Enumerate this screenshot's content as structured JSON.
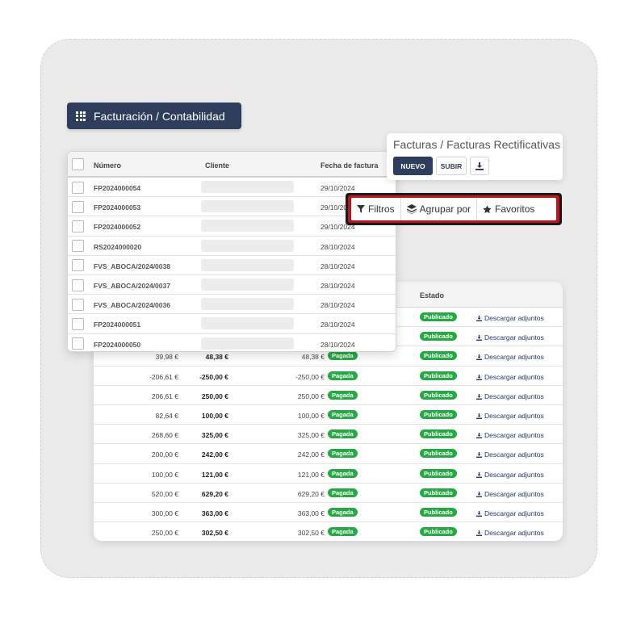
{
  "breadcrumb": {
    "label": "Facturación / Contabilidad"
  },
  "panel": {
    "title": "Facturas / Facturas Rectificativas",
    "buttons": {
      "nuevo": "NUEVO",
      "subir": "SUBIR"
    }
  },
  "filters": {
    "filtros": "Filtros",
    "agrupar": "Agrupar por",
    "favoritos": "Favoritos"
  },
  "colors": {
    "primary": "#2d3e5c",
    "highlight": "#c0141b",
    "success": "#28a745"
  },
  "front_table": {
    "headers": {
      "numero": "Número",
      "cliente": "Cliente",
      "fecha": "Fecha de factura"
    },
    "rows": [
      {
        "numero": "FP2024000054",
        "fecha": "29/10/2024"
      },
      {
        "numero": "FP2024000053",
        "fecha": "29/10/2024"
      },
      {
        "numero": "FP2024000052",
        "fecha": "29/10/2024"
      },
      {
        "numero": "RS2024000020",
        "fecha": "28/10/2024"
      },
      {
        "numero": "FVS_ABOCA/2024/0038",
        "fecha": "28/10/2024"
      },
      {
        "numero": "FVS_ABOCA/2024/0037",
        "fecha": "28/10/2024"
      },
      {
        "numero": "FVS_ABOCA/2024/0036",
        "fecha": "28/10/2024"
      },
      {
        "numero": "FP2024000051",
        "fecha": "28/10/2024"
      },
      {
        "numero": "FP2024000050",
        "fecha": "28/10/2024"
      }
    ]
  },
  "back_table": {
    "headers": {
      "estado": "Estado"
    },
    "labels": {
      "pagada": "Pagada",
      "publicado": "Publicado",
      "descargar": "Descargar adjuntos"
    },
    "rows": [
      {
        "base": "",
        "total": "",
        "pendiente": ""
      },
      {
        "base": "",
        "total": "",
        "pendiente": ""
      },
      {
        "base": "39,98 €",
        "total": "48,38 €",
        "pendiente": "48,38 €"
      },
      {
        "base": "-206,61 €",
        "total": "-250,00 €",
        "pendiente": "-250,00 €"
      },
      {
        "base": "206,61 €",
        "total": "250,00 €",
        "pendiente": "250,00 €"
      },
      {
        "base": "82,64 €",
        "total": "100,00 €",
        "pendiente": "100,00 €"
      },
      {
        "base": "268,60 €",
        "total": "325,00 €",
        "pendiente": "325,00 €"
      },
      {
        "base": "200,00 €",
        "total": "242,00 €",
        "pendiente": "242,00 €"
      },
      {
        "base": "100,00 €",
        "total": "121,00 €",
        "pendiente": "121,00 €"
      },
      {
        "base": "520,00 €",
        "total": "629,20 €",
        "pendiente": "629,20 €"
      },
      {
        "base": "300,00 €",
        "total": "363,00 €",
        "pendiente": "363,00 €"
      },
      {
        "base": "250,00 €",
        "total": "302,50 €",
        "pendiente": "302,50 €"
      }
    ]
  }
}
